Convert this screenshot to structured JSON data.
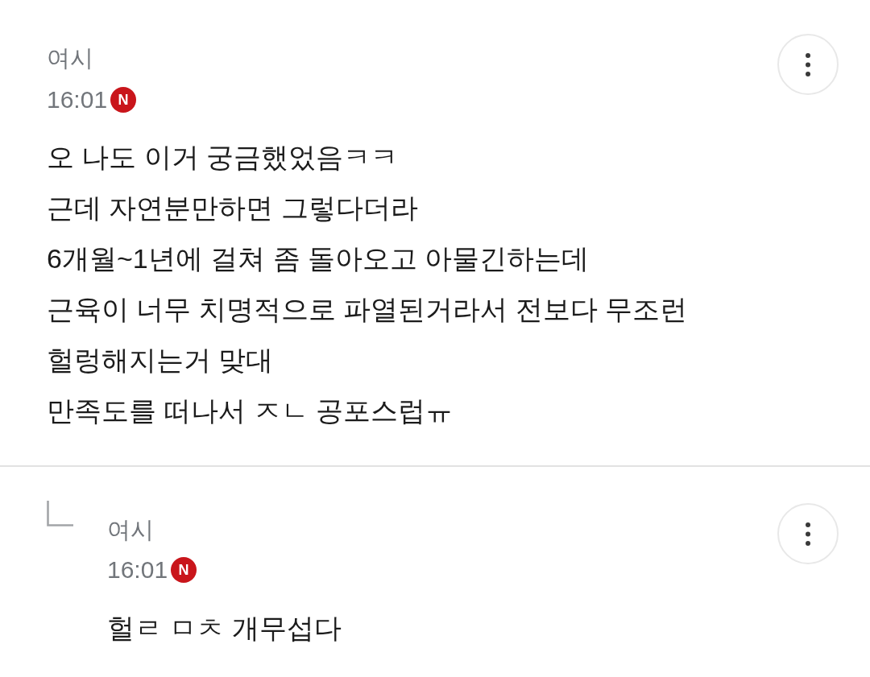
{
  "comments": [
    {
      "kind": "comment",
      "author": "여시",
      "time": "16:01",
      "badge": "N",
      "body": "오 나도 이거 궁금했었음ㅋㅋ\n근데 자연분만하면 그렇다더라\n6개월~1년에 걸쳐 좀 돌아오고 아물긴하는데\n근육이 너무 치명적으로 파열된거라서 전보다 무조런\n헐렁해지는거 맞대\n만족도를 떠나서 ㅈㄴ 공포스럽ㅠ"
    },
    {
      "kind": "reply",
      "author": "여시",
      "time": "16:01",
      "badge": "N",
      "body": "헐ㄹ ㅁㅊ 개무섭다"
    }
  ]
}
